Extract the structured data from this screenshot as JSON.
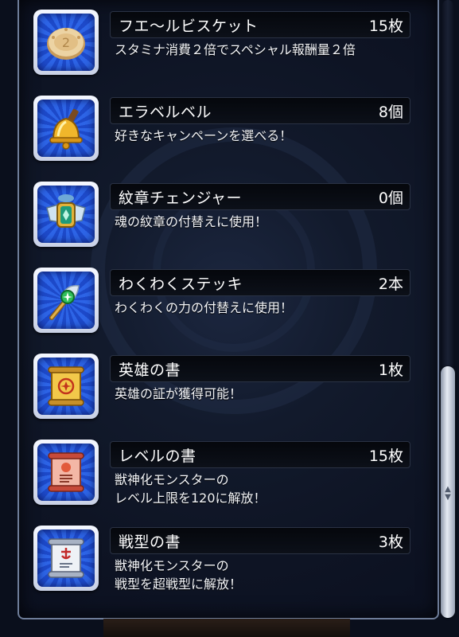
{
  "items": [
    {
      "name": "フエ～ルビスケット",
      "count": "15枚",
      "desc": [
        "スタミナ消費２倍でスペシャル報酬量２倍"
      ],
      "icon": "biscuit-icon"
    },
    {
      "name": "エラベルベル",
      "count": "8個",
      "desc": [
        "好きなキャンペーンを選べる！"
      ],
      "icon": "bell-icon"
    },
    {
      "name": "紋章チェンジャー",
      "count": "0個",
      "desc": [
        "魂の紋章の付替えに使用！"
      ],
      "icon": "emblem-changer-icon"
    },
    {
      "name": "わくわくステッキ",
      "count": "2本",
      "desc": [
        "わくわくの力の付替えに使用！"
      ],
      "icon": "wand-icon"
    },
    {
      "name": "英雄の書",
      "count": "1枚",
      "desc": [
        "英雄の証が獲得可能！"
      ],
      "icon": "hero-scroll-icon"
    },
    {
      "name": "レベルの書",
      "count": "15枚",
      "desc": [
        "獣神化モンスターの",
        "レベル上限を120に解放！"
      ],
      "icon": "level-scroll-icon"
    },
    {
      "name": "戦型の書",
      "count": "3枚",
      "desc": [
        "獣神化モンスターの",
        "戦型を超戦型に解放！"
      ],
      "icon": "battle-type-scroll-icon"
    }
  ],
  "colors": {
    "background": "#0a0f1c",
    "icon_blue": "#2d64e6",
    "title_bar": "#05070c",
    "text": "#ffffff"
  }
}
